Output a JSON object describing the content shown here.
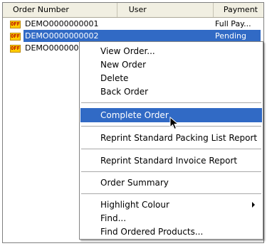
{
  "table": {
    "columns": [
      "Order Number",
      "User",
      "Payment"
    ],
    "rows": [
      {
        "icon": "OFF",
        "number": "DEMO0000000001",
        "payment": "Full Pay..."
      },
      {
        "icon": "OFF",
        "number": "DEMO0000000002",
        "payment": "Pending"
      },
      {
        "icon": "OFF",
        "number": "DEMO0000000",
        "payment": ""
      }
    ],
    "selected_row": 1
  },
  "context_menu": {
    "items": [
      "View Order...",
      "New Order",
      "Delete",
      "Back Order",
      "Complete Order",
      "Reprint Standard Packing List Report",
      "Reprint Standard Invoice Report",
      "Order Summary",
      "Highlight Colour",
      "Find...",
      "Find Ordered Products..."
    ],
    "highlighted": "Complete Order"
  },
  "colors": {
    "selection": "#316ac5",
    "header_bg": "#f1efe2",
    "icon_bg": "#ffcc00"
  },
  "icons": {
    "row_status": "off-status-icon",
    "submenu": "chevron-right-icon",
    "pointer": "mouse-pointer-icon"
  }
}
